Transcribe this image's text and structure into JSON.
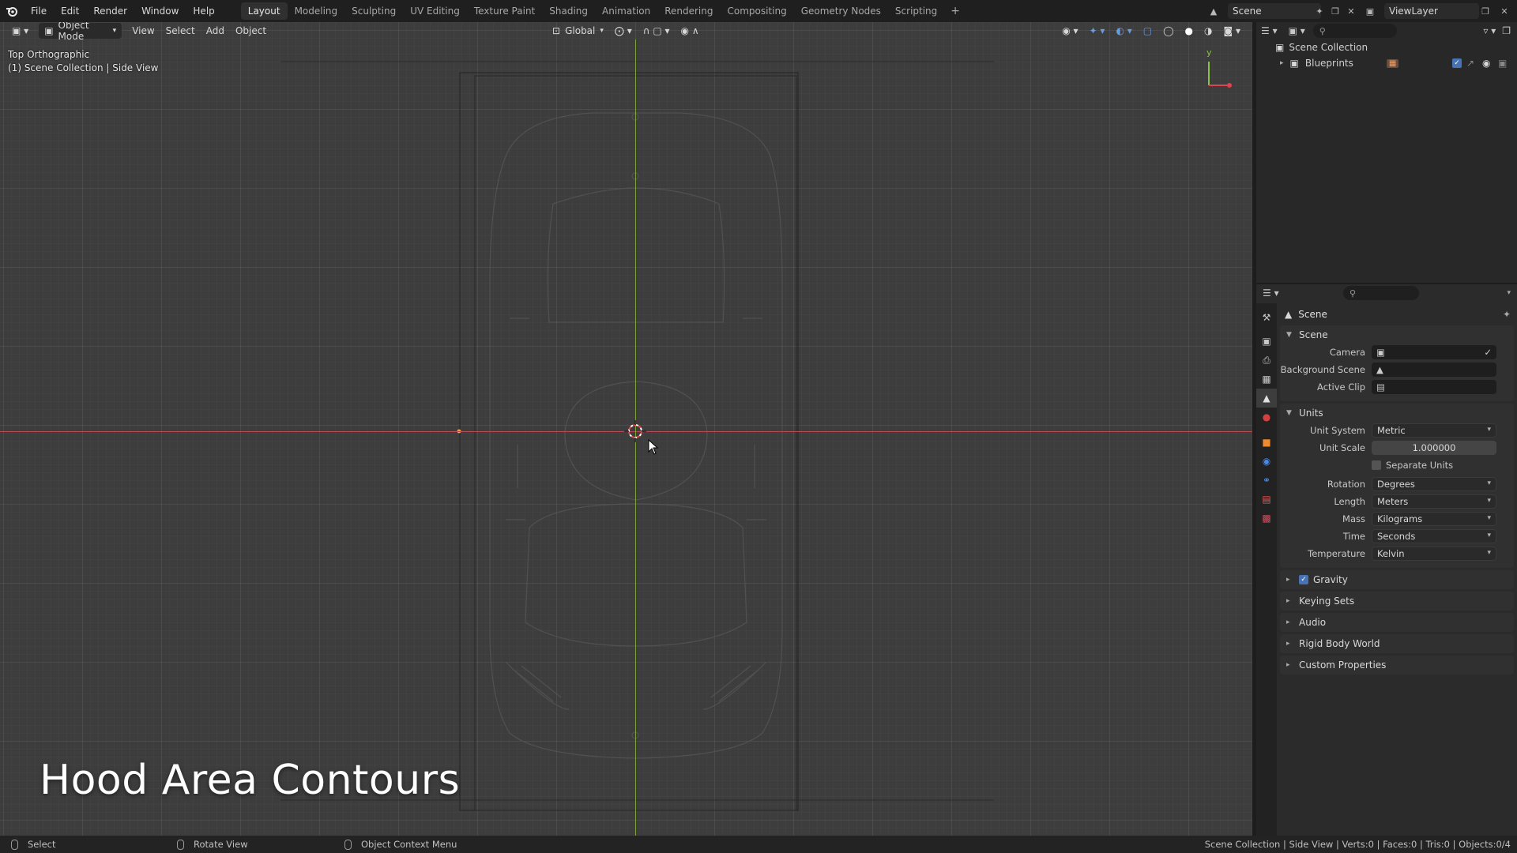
{
  "topbar": {
    "menus": [
      "File",
      "Edit",
      "Render",
      "Window",
      "Help"
    ],
    "workspaces": [
      "Layout",
      "Modeling",
      "Sculpting",
      "UV Editing",
      "Texture Paint",
      "Shading",
      "Animation",
      "Rendering",
      "Compositing",
      "Geometry Nodes",
      "Scripting"
    ],
    "active_workspace": "Layout",
    "add_workspace": "+",
    "scene_name": "Scene",
    "view_layer": "ViewLayer"
  },
  "viewport": {
    "mode": "Object Mode",
    "menus": [
      "View",
      "Select",
      "Add",
      "Object"
    ],
    "orientation": "Global",
    "view_name": "Top Orthographic",
    "collection_info": "(1) Scene Collection | Side View",
    "overlay_title": "Hood Area Contours",
    "x_axis_color": "#b84a55",
    "y_axis_color": "#7ea33a",
    "gizmo_y_label": "y"
  },
  "outliner": {
    "root": "Scene Collection",
    "items": [
      {
        "label": "Blueprints"
      }
    ]
  },
  "properties": {
    "context_title": "Scene",
    "panels": {
      "scene": {
        "title": "Scene",
        "camera_label": "Camera",
        "background_scene_label": "Background Scene",
        "active_clip_label": "Active Clip"
      },
      "units": {
        "title": "Units",
        "unit_system_label": "Unit System",
        "unit_system": "Metric",
        "unit_scale_label": "Unit Scale",
        "unit_scale": "1.000000",
        "separate_units_label": "Separate Units",
        "rotation_label": "Rotation",
        "rotation": "Degrees",
        "length_label": "Length",
        "length": "Meters",
        "mass_label": "Mass",
        "mass": "Kilograms",
        "time_label": "Time",
        "time": "Seconds",
        "temperature_label": "Temperature",
        "temperature": "Kelvin"
      },
      "collapsed": [
        "Gravity",
        "Keying Sets",
        "Audio",
        "Rigid Body World",
        "Custom Properties"
      ]
    },
    "accent": "#4772b3"
  },
  "statusbar": {
    "select": "Select",
    "rotate": "Rotate View",
    "context_menu": "Object Context Menu",
    "stats": "Scene Collection | Side View | Verts:0 | Faces:0 | Tris:0 | Objects:0/4"
  }
}
